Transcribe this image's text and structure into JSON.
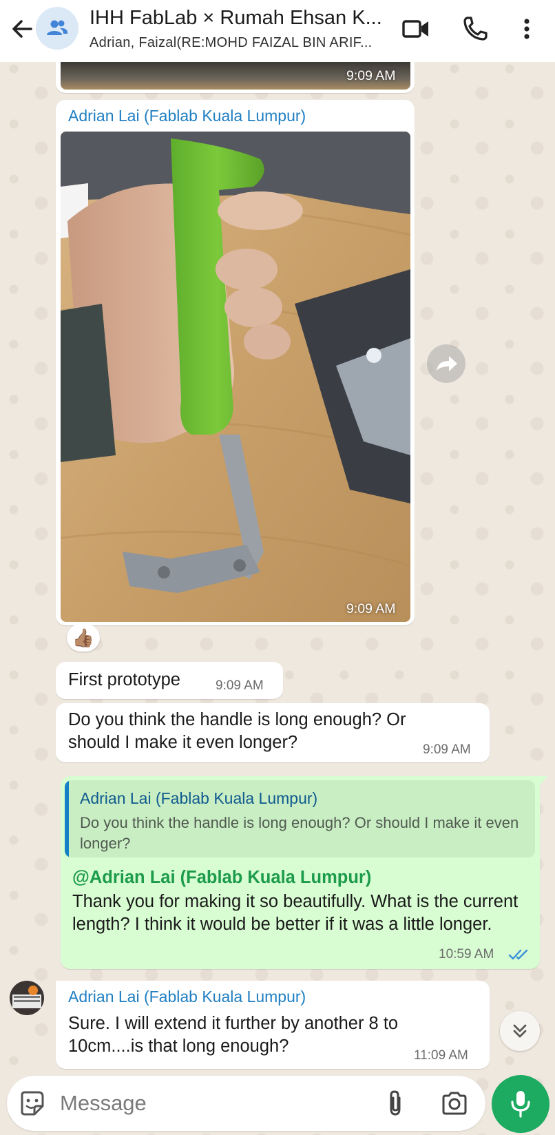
{
  "header": {
    "title": "IHH FabLab × Rumah Ehsan K...",
    "subtitle": "Adrian, Faizal(RE:MOHD FAIZAL BIN ARIF..."
  },
  "messages": {
    "top_photo_time": "9:09 AM",
    "photo_msg": {
      "sender": "Adrian Lai (Fablab Kuala Lumpur)",
      "time": "9:09 AM",
      "reaction": "👍🏽"
    },
    "msg1": {
      "text": "First prototype",
      "time": "9:09 AM"
    },
    "msg2": {
      "text": "Do you think the handle is long enough? Or should I make it even longer?",
      "time": "9:09 AM"
    },
    "reply": {
      "quoted_sender": "Adrian Lai (Fablab Kuala Lumpur)",
      "quoted_text": "Do you think the handle is long enough? Or should I make it even longer?",
      "mention": "@Adrian Lai (Fablab Kuala Lumpur)",
      "text": "Thank you for making it so beautifully. What is the current length? I think it would be better if it was a little longer.",
      "time": "10:59 AM",
      "status": "read"
    },
    "msg3": {
      "sender": "Adrian Lai (Fablab Kuala Lumpur)",
      "text": "Sure. I will extend it further by another 8 to 10cm....is that long enough?",
      "time": "11:09 AM"
    }
  },
  "input": {
    "placeholder": "Message"
  },
  "colors": {
    "outgoing": "#d8fdd2",
    "incoming": "#ffffff",
    "accent": "#1daa61",
    "sender": "#1e7ec2"
  },
  "icons": [
    "back-arrow-icon",
    "group-icon",
    "video-call-icon",
    "phone-icon",
    "more-vert-icon",
    "forward-icon",
    "chevron-double-down-icon",
    "sticker-icon",
    "attach-icon",
    "camera-icon",
    "mic-icon",
    "double-check-icon"
  ]
}
